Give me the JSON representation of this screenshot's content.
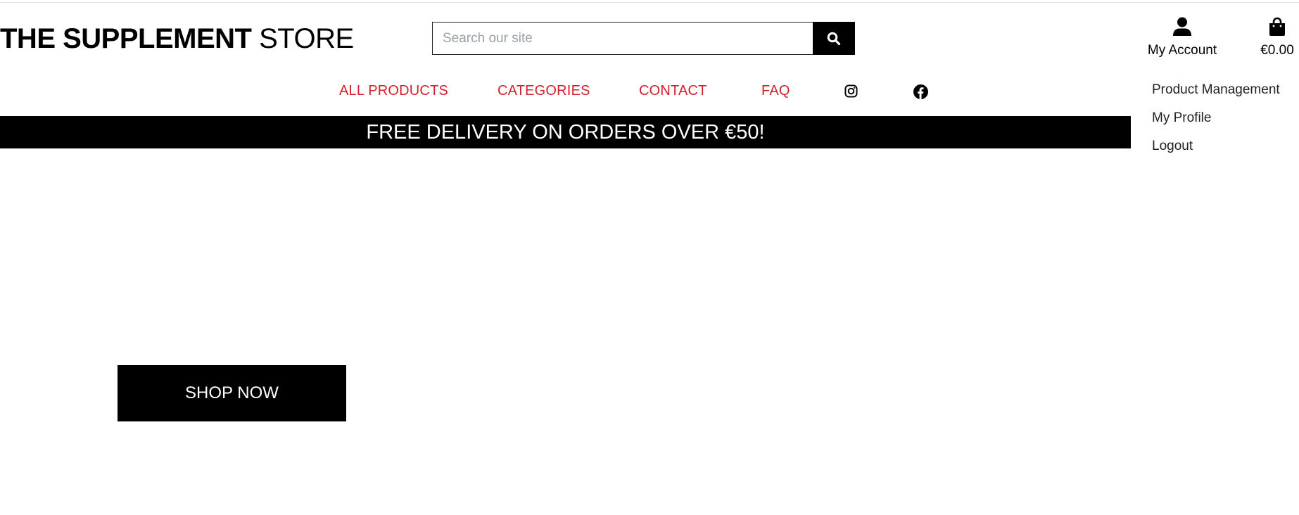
{
  "brand": {
    "bold": "THE SUPPLEMENT",
    "light": "STORE"
  },
  "search": {
    "placeholder": "Search our site",
    "icon": "search-icon"
  },
  "account": {
    "label": "My Account",
    "icon": "user-icon"
  },
  "bag": {
    "total": "€0.00",
    "icon": "shopping-bag-icon"
  },
  "nav": {
    "items": [
      "ALL PRODUCTS",
      "CATEGORIES",
      "CONTACT",
      "FAQ"
    ],
    "social": [
      "instagram-icon",
      "facebook-icon"
    ]
  },
  "account_menu": {
    "items": [
      "Product Management",
      "My Profile",
      "Logout"
    ]
  },
  "banner": {
    "text": "FREE DELIVERY ON ORDERS OVER €50!"
  },
  "hero": {
    "cta": "SHOP NOW"
  },
  "colors": {
    "nav_link": "#d4202c",
    "banner_bg": "#000000",
    "cta_bg": "#000000"
  }
}
